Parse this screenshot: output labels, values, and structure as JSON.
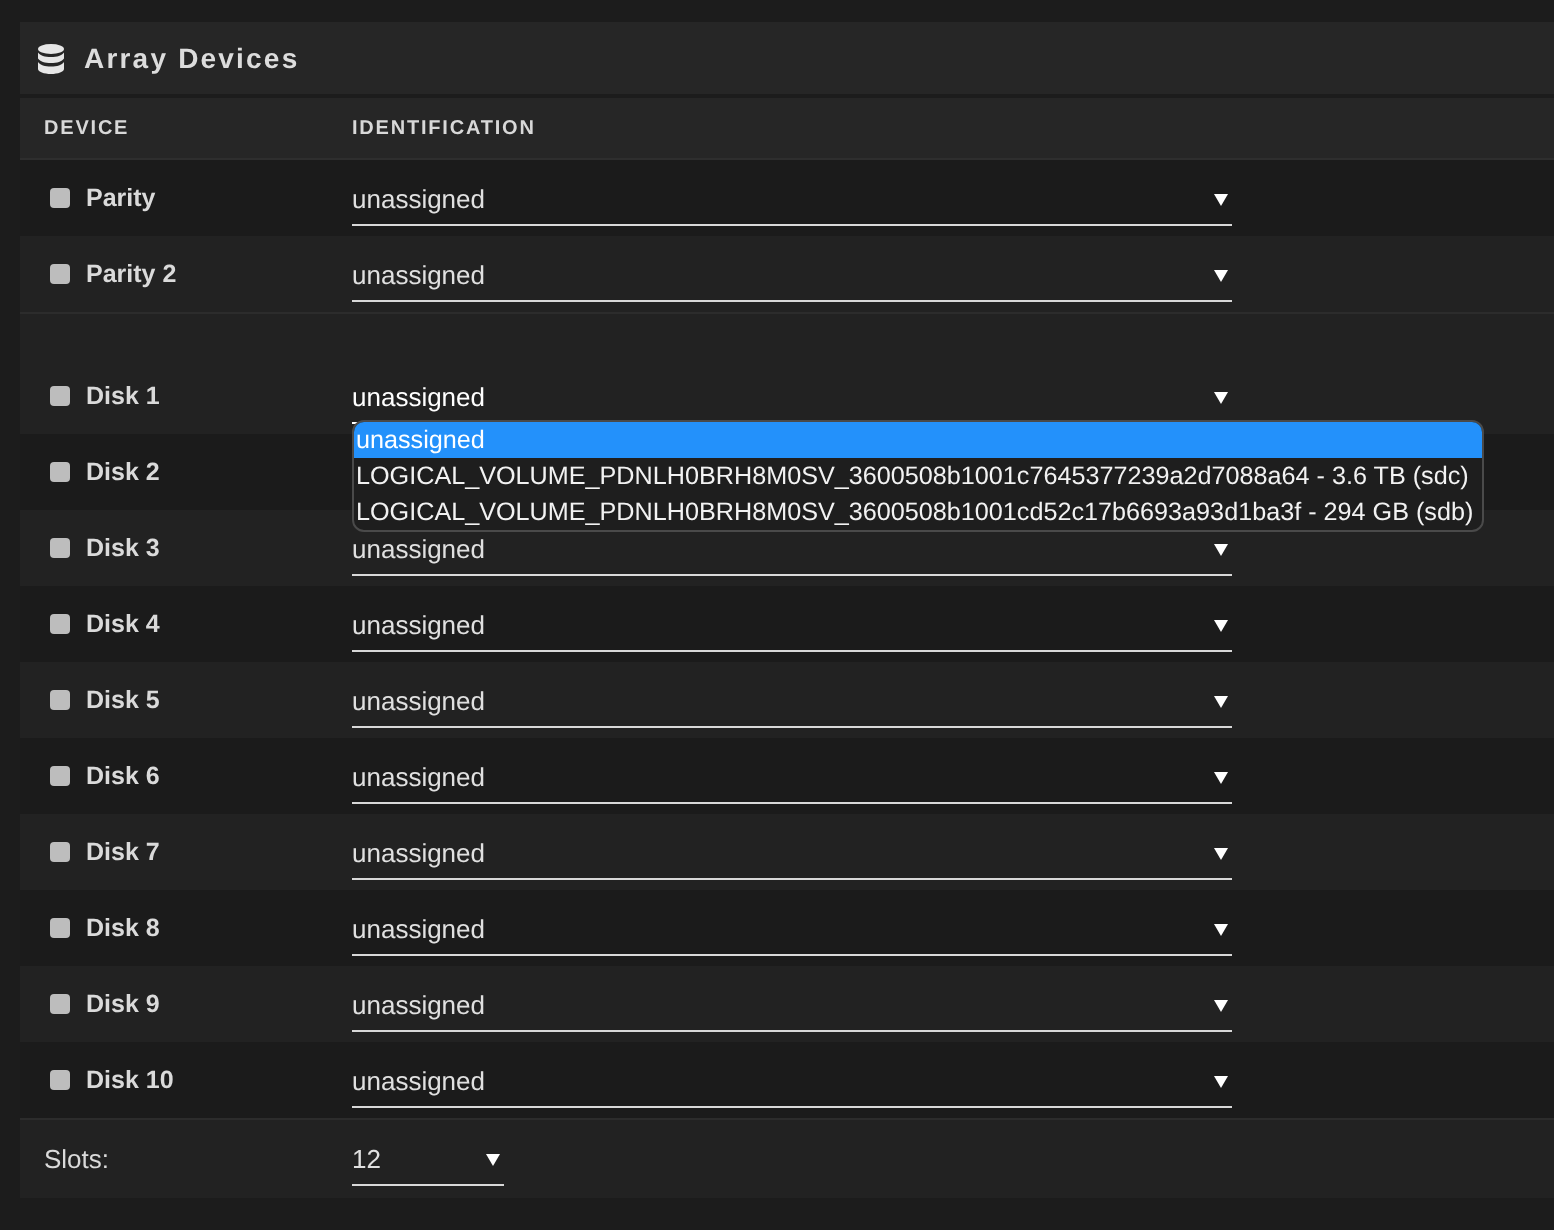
{
  "panel": {
    "title": "Array Devices"
  },
  "columns": [
    "DEVICE",
    "IDENTIFICATION"
  ],
  "parity_devices": [
    {
      "name": "Parity",
      "value": "unassigned",
      "expanded": false
    },
    {
      "name": "Parity 2",
      "value": "unassigned",
      "expanded": false
    }
  ],
  "data_devices": [
    {
      "name": "Disk 1",
      "value": "unassigned",
      "expanded": true,
      "options": [
        {
          "label": "unassigned",
          "selected": true
        },
        {
          "label": "LOGICAL_VOLUME_PDNLH0BRH8M0SV_3600508b1001c7645377239a2d7088a64 - 3.6 TB (sdc)",
          "selected": false
        },
        {
          "label": "LOGICAL_VOLUME_PDNLH0BRH8M0SV_3600508b1001cd52c17b6693a93d1ba3f - 294 GB (sdb)",
          "selected": false
        }
      ]
    },
    {
      "name": "Disk 2"
    },
    {
      "name": "Disk 3",
      "value": "unassigned",
      "expanded": false
    },
    {
      "name": "Disk 4",
      "value": "unassigned",
      "expanded": false
    },
    {
      "name": "Disk 5",
      "value": "unassigned",
      "expanded": false
    },
    {
      "name": "Disk 6",
      "value": "unassigned",
      "expanded": false
    },
    {
      "name": "Disk 7",
      "value": "unassigned",
      "expanded": false
    },
    {
      "name": "Disk 8",
      "value": "unassigned",
      "expanded": false
    },
    {
      "name": "Disk 9",
      "value": "unassigned",
      "expanded": false
    },
    {
      "name": "Disk 10",
      "value": "unassigned",
      "expanded": false
    }
  ],
  "slots": {
    "label": "Slots:",
    "value": "12"
  }
}
